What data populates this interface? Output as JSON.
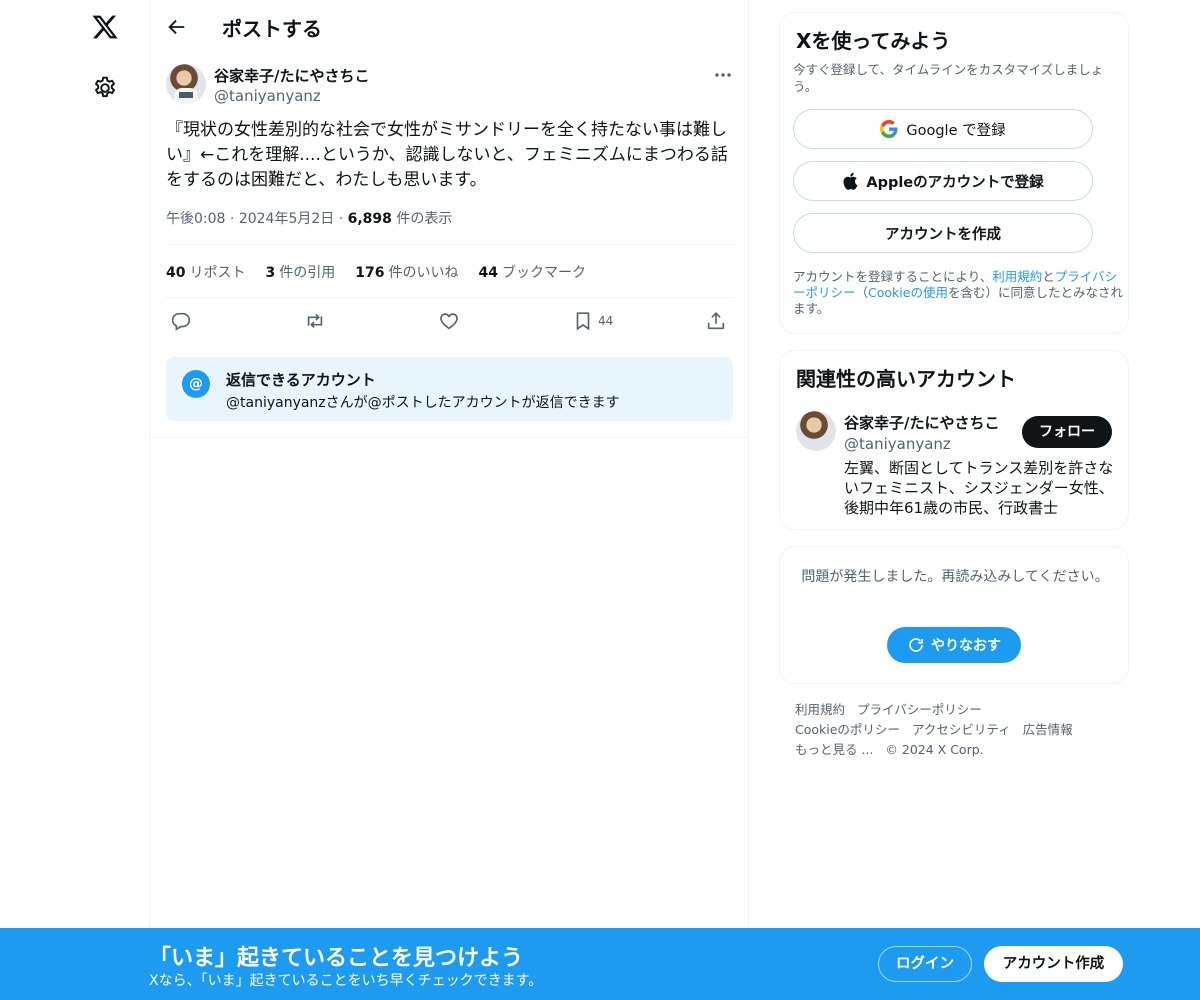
{
  "nav": {
    "logo_icon": "x-logo-icon",
    "settings_icon": "gear-icon"
  },
  "header": {
    "title": "ポストする",
    "back_icon": "arrow-left-icon"
  },
  "post": {
    "author_name": "谷家幸子/たにやさちこ",
    "author_handle": "@taniyanyanz",
    "text": "『現状の女性差別的な社会で女性がミサンドリーを全く持たない事は難しい』←これを理解....というか、認識しないと、フェミニズムにまつわる話をするのは困難だと、わたしも思います。",
    "time": "午後0:08",
    "date": "2024年5月2日",
    "views_count": "6,898",
    "views_label": "件の表示",
    "sep": "·",
    "stats": [
      {
        "count": "40",
        "label": "リポスト"
      },
      {
        "count": "3",
        "label": "件の引用"
      },
      {
        "count": "176",
        "label": "件のいいね"
      },
      {
        "count": "44",
        "label": "ブックマーク"
      }
    ],
    "bookmark_count": "44"
  },
  "reply_restriction": {
    "icon_text": "@",
    "title": "返信できるアカウント",
    "description": "@taniyanyanzさんが@ポストしたアカウントが返信できます"
  },
  "signup": {
    "title": "Xを使ってみよう",
    "subtitle": "今すぐ登録して、タイムラインをカスタマイズしましょう。",
    "google_label": "Google で登録",
    "apple_label": "Appleのアカウントで登録",
    "create_label": "アカウントを作成",
    "legal_prefix": "アカウントを登録することにより、",
    "legal_terms": "利用規約",
    "legal_and": "と",
    "legal_privacy": "プライバシーポリシー",
    "legal_open": "（",
    "legal_cookie": "Cookieの使用",
    "legal_suffix": "を含む）に同意したとみなされます。"
  },
  "related": {
    "title": "関連性の高いアカウント",
    "name": "谷家幸子/たにやさちこ",
    "handle": "@taniyanyanz",
    "follow_label": "フォロー",
    "bio": "左翼、断固としてトランス差別を許さないフェミニスト、シスジェンダー女性、後期中年61歳の市民、行政書士"
  },
  "error": {
    "message": "問題が発生しました。再読み込みしてください。",
    "retry_label": "やりなおす"
  },
  "footer": {
    "links": [
      "利用規約",
      "プライバシーポリシー",
      "Cookieのポリシー",
      "アクセシビリティ",
      "広告情報",
      "もっと見る ..."
    ],
    "copyright": "© 2024 X Corp."
  },
  "banner": {
    "title": "「いま」起きていることを見つけよう",
    "subtitle": "Xなら、「いま」起きていることをいち早くチェックできます。",
    "login_label": "ログイン",
    "create_label": "アカウント作成"
  },
  "colors": {
    "accent": "#1d9bf0",
    "text": "#0f1419",
    "muted": "#536471",
    "border": "#eff3f4"
  }
}
